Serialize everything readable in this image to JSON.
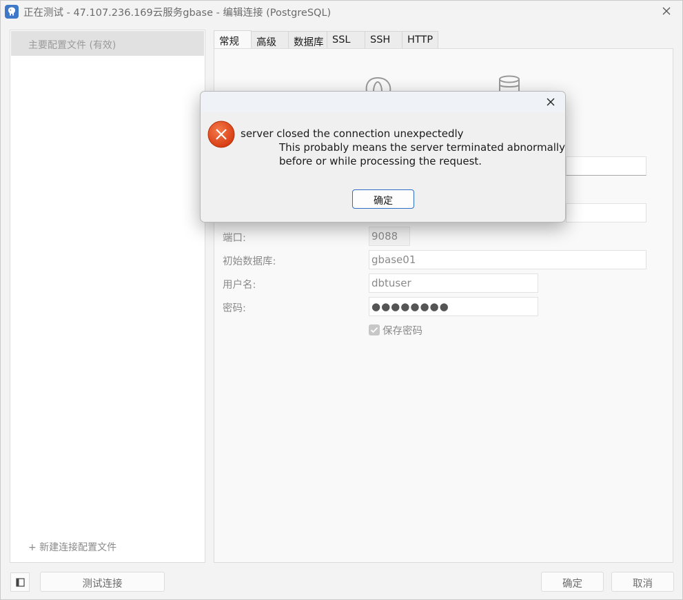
{
  "window": {
    "title": "正在测试 - 47.107.236.169云服务gbase - 编辑连接 (PostgreSQL)"
  },
  "sidebar": {
    "profile_label": "主要配置文件 (有效)",
    "new_profile_label": "+ 新建连接配置文件"
  },
  "tabs": [
    "常规",
    "高级",
    "数据库",
    "SSL",
    "SSH",
    "HTTP"
  ],
  "form": {
    "port_label": "端口:",
    "port_value": "9088",
    "initial_db_label": "初始数据库:",
    "initial_db_value": "gbase01",
    "username_label": "用户名:",
    "username_value": "dbtuser",
    "password_label": "密码:",
    "password_value": "●●●●●●●●",
    "save_password_label": "保存密码",
    "save_password_checked": true
  },
  "footer": {
    "test_connection_label": "测试连接",
    "ok_label": "确定",
    "cancel_label": "取消"
  },
  "dialog": {
    "line1": "server closed the connection unexpectedly",
    "line2": "This probably means the server terminated abnormally",
    "line3": "before or while processing the request.",
    "ok_label": "确定",
    "icon": "error-icon",
    "icon_color": "#e0481c"
  },
  "colors": {
    "accent": "#2c6cc4",
    "error": "#e0481c"
  }
}
